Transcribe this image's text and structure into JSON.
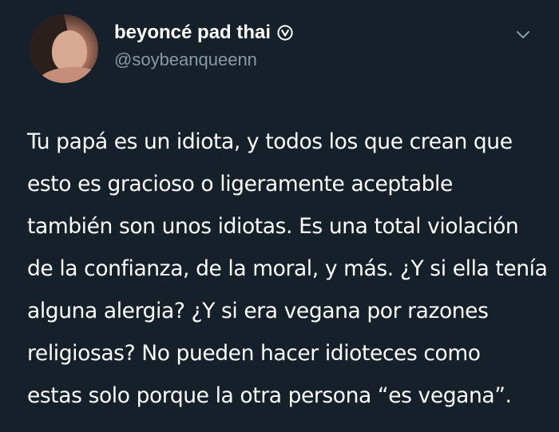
{
  "user": {
    "display_name": "beyoncé pad thai",
    "handle": "@soybeanqueenn",
    "verified_icon": "verified-badge-icon"
  },
  "menu": {
    "icon": "chevron-down-icon"
  },
  "tweet": {
    "lines": [
      "Tu papá es un idiota, y todos los que crean que",
      "esto es gracioso o ligeramente aceptable",
      "también son unos idiotas. Es una total violación",
      "de la confianza, de la moral, y más. ¿Y si ella tenía",
      "alguna alergia? ¿Y si era vegana por razones",
      "religiosas? No pueden hacer idioteces como",
      "estas solo porque la otra persona “es vegana”."
    ]
  },
  "colors": {
    "background": "#15202b",
    "text": "#ffffff",
    "secondary_text": "#8899a6"
  }
}
